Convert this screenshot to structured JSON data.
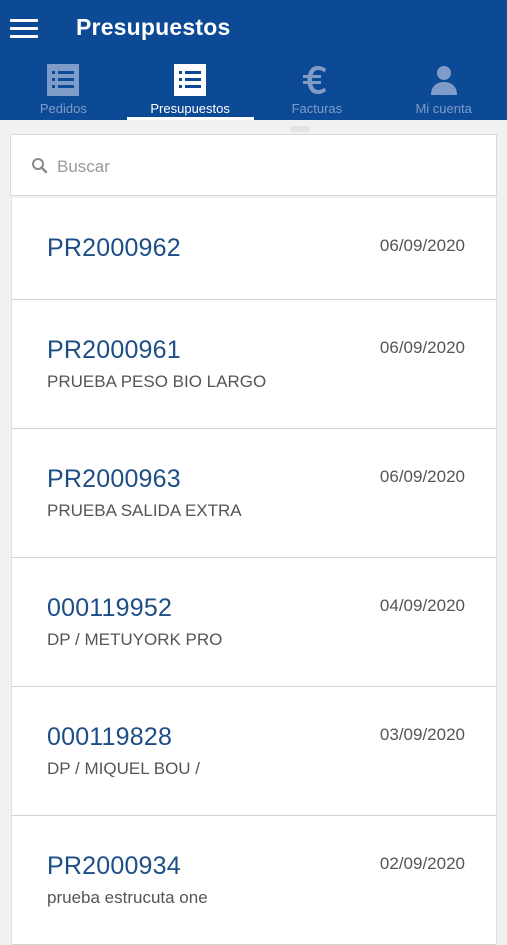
{
  "header": {
    "title": "Presupuestos"
  },
  "tabs": [
    {
      "label": "Pedidos",
      "icon": "list-icon",
      "active": false
    },
    {
      "label": "Presupuestos",
      "icon": "list-icon",
      "active": true
    },
    {
      "label": "Facturas",
      "icon": "euro-icon",
      "active": false
    },
    {
      "label": "Mi cuenta",
      "icon": "user-icon",
      "active": false
    }
  ],
  "search": {
    "placeholder": "Buscar",
    "value": ""
  },
  "items": [
    {
      "code": "PR2000962",
      "date": "06/09/2020",
      "desc": ""
    },
    {
      "code": "PR2000961",
      "date": "06/09/2020",
      "desc": "PRUEBA PESO BIO LARGO"
    },
    {
      "code": "PR2000963",
      "date": "06/09/2020",
      "desc": "PRUEBA SALIDA EXTRA"
    },
    {
      "code": "000119952",
      "date": "04/09/2020",
      "desc": "DP / METUYORK PRO"
    },
    {
      "code": "000119828",
      "date": "03/09/2020",
      "desc": "DP / MIQUEL BOU /"
    },
    {
      "code": "PR2000934",
      "date": "02/09/2020",
      "desc": "prueba estrucuta one"
    }
  ],
  "colors": {
    "appbar": "#0d4a96",
    "code_text": "#1d4e86",
    "inactive_tab": "#7f9cc8"
  }
}
